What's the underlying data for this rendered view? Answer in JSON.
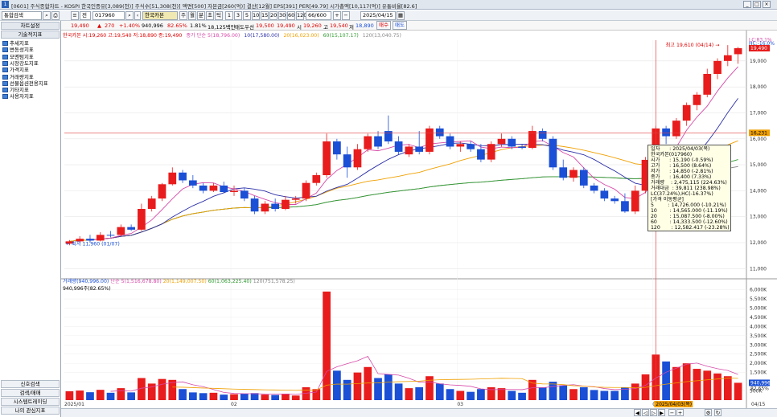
{
  "window": {
    "title": "[0601] 주식종합차트 - KOSPI 한국인증유[3,089(천)] 주식수[51,308(천)] 액면[500] 자본금[260(억)] 결산[12월] EPS[391] PER[49.79] 시가총액[10,117(억)] 유통비율[82.6]",
    "app_badge": "1"
  },
  "toolbar": {
    "search_box": "통합검색",
    "stock_code": "017960",
    "stock_name": "한국카본",
    "period_day": "주",
    "period_week": "월",
    "period_month": "분",
    "period_min": "초",
    "period_tick": "틱",
    "intervals": [
      "1",
      "3",
      "5",
      "10",
      "15",
      "20",
      "30",
      "60",
      "120"
    ],
    "count": "66/600",
    "date": "2025/04/15"
  },
  "toolbar2": {
    "price": "19,490",
    "arrow": "▲",
    "change": "270",
    "change_pct": "+1.40%",
    "volume": "940,996",
    "turnover": "82.65%",
    "rate": "1.81%",
    "amount": "18,125백만",
    "best_ask_label": "매도우선",
    "best_ask": "19,500",
    "best_bid": "19,490",
    "open_label": "시",
    "open": "19,260",
    "high_label": "고",
    "high": "19,540",
    "low_label": "저",
    "low": "18,890",
    "buy_label": "매수",
    "sell_label": "매도"
  },
  "sidebar": {
    "top_tab": "차트설정",
    "section_title": "기술적지표",
    "items": [
      "추세지표",
      "변동성지표",
      "모멘텀지표",
      "시장강도지표",
      "가격지표",
      "거래량지표",
      "선물옵션전용지표",
      "기타지표",
      "사용자지표"
    ],
    "footer": [
      "신호검색",
      "검색/매매",
      "시스템트레이딩",
      "나의 관심지표"
    ]
  },
  "price_legend": {
    "main": "한국카본 시:19,260 고:19,540 저:18,890 종:19,490",
    "ma_label": "종가 단순 5(18,796.00)",
    "ma10": "10(17,580.00)",
    "ma20": "20(16,023.00)",
    "ma60": "60(15,107.17)",
    "ma120": "120(13,040.75)"
  },
  "volume_legend": {
    "line1_a": "거래량(940,996.00)",
    "line1_b": "단순 5(1,516,678.80)",
    "line1_c": "20(1,149,007.50)",
    "line1_d": "60(1,063,225.40)",
    "line1_e": "120(751,578.25)",
    "line2": "940,996주(82.65%)"
  },
  "annotations": {
    "high": "최고 19,610 (04/14) →",
    "low": "← 최저 11,960 (01/07)",
    "lc": "LC:83.1%",
    "hc": "HC:-16.0%",
    "last_price_tag": "19,490",
    "crosshair_price": "16,231",
    "crosshair_date": "2025/04/03(목)",
    "vol_last": "940,996",
    "vol_pct": "82.65%"
  },
  "tooltip": {
    "lines": [
      "일자      : 2025/04/03(목)",
      "한국카본(017960)",
      "시가      : 15,190 (-0.59%)",
      "고가      : 16,500 (8.64%)",
      "저가      : 14,850 (-2.81%)",
      "종가      : 16,400 (7.33%)",
      "거래량    : 2,475,115 (224.63%)",
      "거래대금  : 39,811 (238.98%)",
      "LC(37.24%),HC(-16.37%)",
      "[가격 이동평균]",
      "5         : 14,726.000 (-10.21%)",
      "10        : 14,565.000 (-11.19%)",
      "20        : 15,087.500 (-8.00%)",
      "60        : 14,333.500 (-12.60%)",
      "120       : 12,582.417 (-23.28%)"
    ]
  },
  "price_axis": [
    "19,000",
    "18,000",
    "17,000",
    "16,000",
    "15,000",
    "14,000",
    "13,000",
    "12,000",
    "11,000"
  ],
  "volume_axis": [
    "6,000K",
    "5,500K",
    "5,000K",
    "4,500K",
    "4,000K",
    "3,500K",
    "3,000K",
    "2,500K",
    "2,000K",
    "1,500K",
    "1,000K",
    "500K"
  ],
  "x_axis": [
    "2025/01",
    "02",
    "03",
    "04",
    "04/15"
  ],
  "chart_data": {
    "type": "candlestick",
    "title": "",
    "xlabel": "",
    "ylabel": "",
    "ylim": [
      10700,
      19800
    ],
    "volume_ylim": [
      0,
      6200000
    ],
    "candles": [
      {
        "o": 11960,
        "h": 12100,
        "l": 11900,
        "c": 12050,
        "v": 480000
      },
      {
        "o": 12050,
        "h": 12250,
        "l": 11980,
        "c": 12150,
        "v": 520000
      },
      {
        "o": 12150,
        "h": 12300,
        "l": 12000,
        "c": 12080,
        "v": 430000
      },
      {
        "o": 12080,
        "h": 12400,
        "l": 12050,
        "c": 12300,
        "v": 560000
      },
      {
        "o": 12300,
        "h": 12450,
        "l": 12200,
        "c": 12280,
        "v": 400000
      },
      {
        "o": 12300,
        "h": 12700,
        "l": 12250,
        "c": 12600,
        "v": 650000
      },
      {
        "o": 12600,
        "h": 12700,
        "l": 12450,
        "c": 12500,
        "v": 420000
      },
      {
        "o": 12500,
        "h": 13500,
        "l": 12450,
        "c": 13300,
        "v": 1200000
      },
      {
        "o": 13300,
        "h": 13800,
        "l": 13200,
        "c": 13700,
        "v": 900000
      },
      {
        "o": 13700,
        "h": 14300,
        "l": 13600,
        "c": 14250,
        "v": 1150000
      },
      {
        "o": 14250,
        "h": 14900,
        "l": 14200,
        "c": 14700,
        "v": 1100000
      },
      {
        "o": 14700,
        "h": 14800,
        "l": 14300,
        "c": 14400,
        "v": 600000
      },
      {
        "o": 14400,
        "h": 14600,
        "l": 14100,
        "c": 14200,
        "v": 420000
      },
      {
        "o": 14200,
        "h": 14300,
        "l": 13900,
        "c": 14000,
        "v": 380000
      },
      {
        "o": 14000,
        "h": 14300,
        "l": 13950,
        "c": 14200,
        "v": 400000
      },
      {
        "o": 14200,
        "h": 14350,
        "l": 13900,
        "c": 13950,
        "v": 300000
      },
      {
        "o": 13950,
        "h": 14200,
        "l": 13800,
        "c": 14000,
        "v": 320000
      },
      {
        "o": 14000,
        "h": 14100,
        "l": 13600,
        "c": 13700,
        "v": 350000
      },
      {
        "o": 13700,
        "h": 13800,
        "l": 13100,
        "c": 13200,
        "v": 380000
      },
      {
        "o": 13200,
        "h": 13600,
        "l": 13100,
        "c": 13500,
        "v": 300000
      },
      {
        "o": 13500,
        "h": 13700,
        "l": 13200,
        "c": 13300,
        "v": 280000
      },
      {
        "o": 13300,
        "h": 13800,
        "l": 13250,
        "c": 13650,
        "v": 350000
      },
      {
        "o": 13650,
        "h": 13800,
        "l": 13500,
        "c": 13700,
        "v": 250000
      },
      {
        "o": 13700,
        "h": 14400,
        "l": 13600,
        "c": 14300,
        "v": 700000
      },
      {
        "o": 14300,
        "h": 14700,
        "l": 14200,
        "c": 14600,
        "v": 600000
      },
      {
        "o": 14600,
        "h": 16200,
        "l": 14500,
        "c": 15900,
        "v": 5900000
      },
      {
        "o": 15900,
        "h": 16000,
        "l": 15200,
        "c": 15400,
        "v": 1600000
      },
      {
        "o": 15400,
        "h": 15700,
        "l": 14500,
        "c": 14900,
        "v": 1100000
      },
      {
        "o": 14900,
        "h": 15800,
        "l": 14800,
        "c": 15600,
        "v": 1500000
      },
      {
        "o": 15600,
        "h": 16200,
        "l": 15500,
        "c": 16100,
        "v": 1800000
      },
      {
        "o": 16100,
        "h": 16300,
        "l": 15600,
        "c": 15700,
        "v": 1200000
      },
      {
        "o": 16300,
        "h": 16900,
        "l": 15800,
        "c": 15900,
        "v": 1400000
      },
      {
        "o": 15900,
        "h": 16100,
        "l": 15400,
        "c": 15500,
        "v": 900000
      },
      {
        "o": 15400,
        "h": 15800,
        "l": 15300,
        "c": 15700,
        "v": 650000
      },
      {
        "o": 15700,
        "h": 16300,
        "l": 15400,
        "c": 15500,
        "v": 700000
      },
      {
        "o": 15500,
        "h": 16500,
        "l": 15400,
        "c": 16400,
        "v": 1300000
      },
      {
        "o": 16400,
        "h": 16500,
        "l": 16000,
        "c": 16100,
        "v": 900000
      },
      {
        "o": 16100,
        "h": 16200,
        "l": 15600,
        "c": 15700,
        "v": 600000
      },
      {
        "o": 15700,
        "h": 15900,
        "l": 15500,
        "c": 15800,
        "v": 500000
      },
      {
        "o": 15800,
        "h": 15900,
        "l": 15500,
        "c": 15600,
        "v": 450000
      },
      {
        "o": 15600,
        "h": 15800,
        "l": 15100,
        "c": 15200,
        "v": 600000
      },
      {
        "o": 15200,
        "h": 15900,
        "l": 15100,
        "c": 15800,
        "v": 700000
      },
      {
        "o": 15800,
        "h": 16200,
        "l": 15700,
        "c": 16000,
        "v": 650000
      },
      {
        "o": 16000,
        "h": 16100,
        "l": 15600,
        "c": 15700,
        "v": 500000
      },
      {
        "o": 15700,
        "h": 15800,
        "l": 15600,
        "c": 15650,
        "v": 400000
      },
      {
        "o": 15650,
        "h": 16500,
        "l": 15600,
        "c": 16300,
        "v": 1100000
      },
      {
        "o": 16300,
        "h": 16400,
        "l": 15900,
        "c": 16000,
        "v": 700000
      },
      {
        "o": 16000,
        "h": 16100,
        "l": 14800,
        "c": 14900,
        "v": 1000000
      },
      {
        "o": 14900,
        "h": 15200,
        "l": 14400,
        "c": 14500,
        "v": 800000
      },
      {
        "o": 14500,
        "h": 14900,
        "l": 14350,
        "c": 14800,
        "v": 600000
      },
      {
        "o": 14800,
        "h": 14900,
        "l": 14100,
        "c": 14200,
        "v": 700000
      },
      {
        "o": 14200,
        "h": 14300,
        "l": 13900,
        "c": 14000,
        "v": 550000
      },
      {
        "o": 14000,
        "h": 14100,
        "l": 13600,
        "c": 13700,
        "v": 500000
      },
      {
        "o": 13700,
        "h": 13800,
        "l": 13500,
        "c": 13600,
        "v": 500000
      },
      {
        "o": 13600,
        "h": 13900,
        "l": 13150,
        "c": 13200,
        "v": 700000
      },
      {
        "o": 13200,
        "h": 14200,
        "l": 13100,
        "c": 14000,
        "v": 900000
      },
      {
        "o": 14000,
        "h": 15300,
        "l": 13900,
        "c": 15190,
        "v": 1400000
      },
      {
        "o": 15190,
        "h": 16500,
        "l": 14850,
        "c": 16400,
        "v": 2475115
      },
      {
        "o": 16400,
        "h": 16500,
        "l": 15800,
        "c": 16100,
        "v": 2100000
      },
      {
        "o": 16100,
        "h": 16800,
        "l": 16000,
        "c": 16700,
        "v": 1800000
      },
      {
        "o": 16700,
        "h": 17400,
        "l": 16500,
        "c": 17300,
        "v": 2000000
      },
      {
        "o": 17300,
        "h": 17800,
        "l": 17100,
        "c": 17700,
        "v": 1700000
      },
      {
        "o": 17700,
        "h": 18700,
        "l": 17600,
        "c": 18500,
        "v": 1600000
      },
      {
        "o": 18500,
        "h": 19100,
        "l": 18300,
        "c": 19000,
        "v": 1450000
      },
      {
        "o": 19000,
        "h": 19610,
        "l": 18800,
        "c": 19220,
        "v": 1300000
      },
      {
        "o": 19260,
        "h": 19540,
        "l": 18890,
        "c": 19490,
        "v": 940996
      }
    ]
  },
  "colors": {
    "up": "#e81c1c",
    "down": "#1a4fd6",
    "ma5": "#d64aa8",
    "ma10": "#2b2fa8",
    "ma20": "#f0a000",
    "ma60": "#2f9a2f",
    "ma120": "#888888"
  }
}
